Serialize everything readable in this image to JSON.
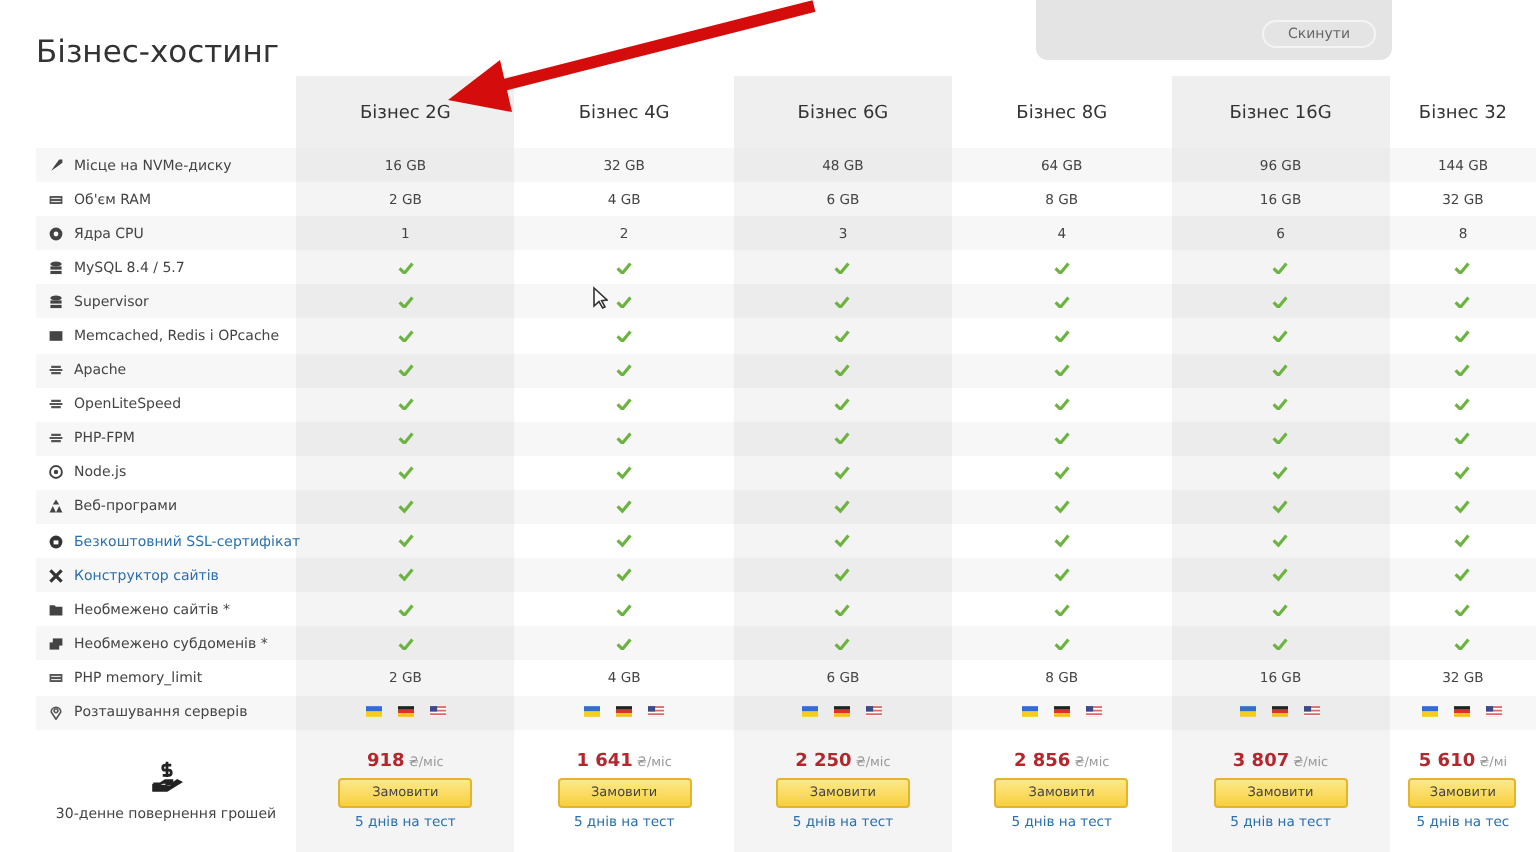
{
  "title": "Бізнес-хостинг",
  "zoom_popup": {
    "reset_button": "Скинути"
  },
  "plans": [
    {
      "name": "Бізнес 2G",
      "shaded": true
    },
    {
      "name": "Бізнес 4G",
      "shaded": false
    },
    {
      "name": "Бізнес 6G",
      "shaded": true
    },
    {
      "name": "Бізнес 8G",
      "shaded": false
    },
    {
      "name": "Бізнес 16G",
      "shaded": true
    },
    {
      "name": "Бізнес 32",
      "shaded": false
    }
  ],
  "rows": [
    {
      "label": "Місце на NVMe-диску",
      "link": false,
      "kind": "text",
      "values": [
        "16 GB",
        "32 GB",
        "48 GB",
        "64 GB",
        "96 GB",
        "144 GB"
      ]
    },
    {
      "label": "Об'єм RAM",
      "link": false,
      "kind": "text",
      "values": [
        "2 GB",
        "4 GB",
        "6 GB",
        "8 GB",
        "16 GB",
        "32 GB"
      ]
    },
    {
      "label": "Ядра CPU",
      "link": false,
      "kind": "text",
      "values": [
        "1",
        "2",
        "3",
        "4",
        "6",
        "8"
      ]
    },
    {
      "label": "MySQL 8.4 / 5.7",
      "link": false,
      "kind": "check",
      "included": [
        true,
        true,
        true,
        true,
        true,
        true
      ]
    },
    {
      "label": "Supervisor",
      "link": false,
      "kind": "check",
      "included": [
        true,
        true,
        true,
        true,
        true,
        true
      ]
    },
    {
      "label": "Memcached, Redis і OPcache",
      "link": false,
      "kind": "check",
      "included": [
        true,
        true,
        true,
        true,
        true,
        true
      ]
    },
    {
      "label": "Apache",
      "link": false,
      "kind": "check",
      "included": [
        true,
        true,
        true,
        true,
        true,
        true
      ]
    },
    {
      "label": "OpenLiteSpeed",
      "link": false,
      "kind": "check",
      "included": [
        true,
        true,
        true,
        true,
        true,
        true
      ]
    },
    {
      "label": "PHP-FPM",
      "link": false,
      "kind": "check",
      "included": [
        true,
        true,
        true,
        true,
        true,
        true
      ]
    },
    {
      "label": "Node.js",
      "link": false,
      "kind": "check",
      "included": [
        true,
        true,
        true,
        true,
        true,
        true
      ]
    },
    {
      "label": "Веб-програми",
      "link": false,
      "kind": "check",
      "included": [
        true,
        true,
        true,
        true,
        true,
        true
      ]
    },
    {
      "label": "Безкоштовний SSL-сертифікат",
      "link": true,
      "kind": "check",
      "included": [
        true,
        true,
        true,
        true,
        true,
        true
      ]
    },
    {
      "label": "Конструктор сайтів",
      "link": true,
      "kind": "check",
      "included": [
        true,
        true,
        true,
        true,
        true,
        true
      ]
    },
    {
      "label": "Необмежено сайтів *",
      "link": false,
      "kind": "check",
      "included": [
        true,
        true,
        true,
        true,
        true,
        true
      ]
    },
    {
      "label": "Необмежено субдоменів *",
      "link": false,
      "kind": "check",
      "included": [
        true,
        true,
        true,
        true,
        true,
        true
      ]
    },
    {
      "label": "PHP memory_limit",
      "link": false,
      "kind": "text",
      "values": [
        "2 GB",
        "4 GB",
        "6 GB",
        "8 GB",
        "16 GB",
        "32 GB"
      ]
    },
    {
      "label": "Розташування серверів",
      "link": false,
      "kind": "flags"
    }
  ],
  "footer": {
    "guarantee": "30-денне повернення грошей",
    "offers": [
      {
        "price": "918",
        "unit": "₴/міс",
        "button": "Замовити",
        "trial": "5 днів на тест"
      },
      {
        "price": "1 641",
        "unit": "₴/міс",
        "button": "Замовити",
        "trial": "5 днів на тест"
      },
      {
        "price": "2 250",
        "unit": "₴/міс",
        "button": "Замовити",
        "trial": "5 днів на тест"
      },
      {
        "price": "2 856",
        "unit": "₴/міс",
        "button": "Замовити",
        "trial": "5 днів на тест"
      },
      {
        "price": "3 807",
        "unit": "₴/міс",
        "button": "Замовити",
        "trial": "5 днів на тест"
      },
      {
        "price": "5 610",
        "unit": "₴/мі",
        "button": "Замовити",
        "trial": "5 днів на тес"
      }
    ]
  }
}
